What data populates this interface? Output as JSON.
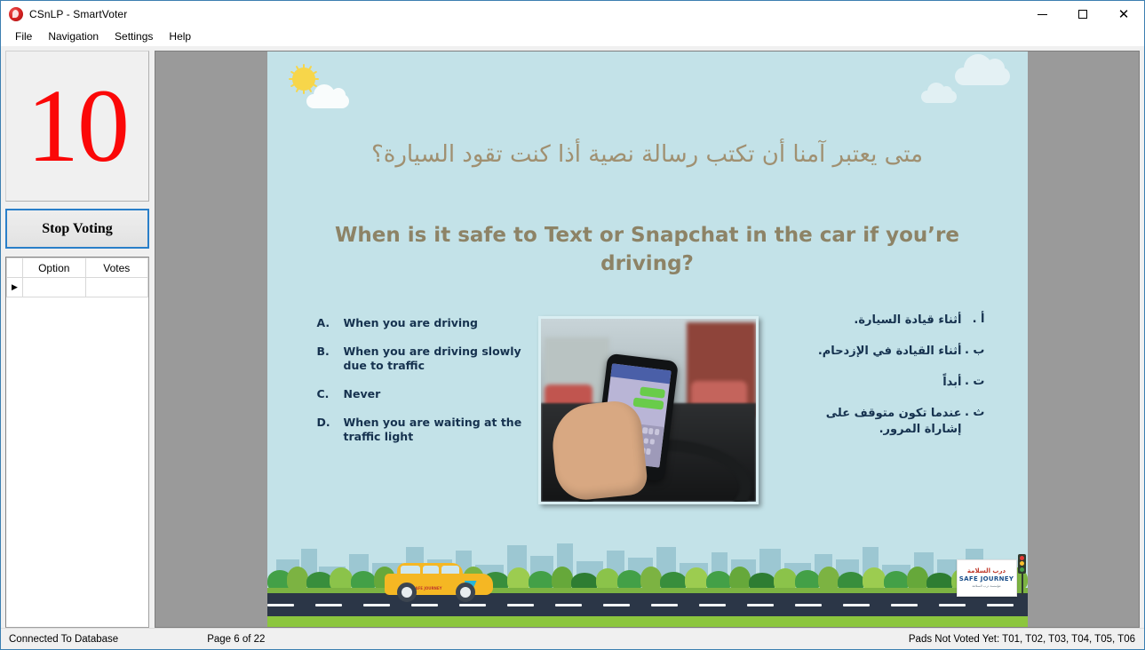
{
  "window": {
    "title": "CSnLP - SmartVoter",
    "icon": "app-logo-icon",
    "controls": {
      "minimize": "–",
      "maximize": "☐",
      "close": "✕"
    }
  },
  "menubar": {
    "items": [
      {
        "label": "File"
      },
      {
        "label": "Navigation"
      },
      {
        "label": "Settings"
      },
      {
        "label": "Help"
      }
    ]
  },
  "sidebar": {
    "countdown": "10",
    "stop_button": "Stop Voting",
    "grid": {
      "columns": [
        "Option",
        "Votes"
      ],
      "rows": [
        {
          "option": "",
          "votes": ""
        }
      ],
      "row_marker": "▶"
    }
  },
  "slide": {
    "question_arabic": "متى يعتبر آمنا أن تكتب رسالة نصية أذا كنت تقود السيارة؟",
    "question_english": "When is it safe to Text or Snapchat in the car if you’re driving?",
    "answers_english": [
      {
        "letter": "A.",
        "text": "When you are driving"
      },
      {
        "letter": "B.",
        "text": "When you are driving slowly due to traffic"
      },
      {
        "letter": "C.",
        "text": "Never"
      },
      {
        "letter": "D.",
        "text": "When you are waiting at the traffic light"
      }
    ],
    "answers_arabic": [
      {
        "letter": "أ .",
        "text": "أثناء قيادة السيارة."
      },
      {
        "letter": "ب .",
        "text": "أثناء القيادة في الإزدحام."
      },
      {
        "letter": "ت .",
        "text": "أبداً"
      },
      {
        "letter": "ث .",
        "text": "عندما تكون متوقف على إشاراة المرور."
      }
    ],
    "photo_alt": "hand-holding-phone-while-driving-photo",
    "billboard": {
      "arabic": "درب السلامة",
      "english": "SAFE JOURNEY",
      "subtitle": "مؤسسة درب السلامة"
    },
    "vehicle_label": "SAFE JOURNEY"
  },
  "statusbar": {
    "connection": "Connected To Database",
    "page": "Page 6 of 22",
    "pads": "Pads Not Voted Yet: T01, T02, T03, T04, T05, T06"
  },
  "colors": {
    "countdown_red": "#fb0808",
    "focus_blue": "#2a7fc9",
    "slide_sky": "#c3e2e8",
    "question_text": "#a09071",
    "answer_text": "#16324f",
    "road": "#2b3647",
    "grass": "#8cc63e",
    "vehicle": "#f5b723",
    "letterbox_gray": "#9a9a9a"
  }
}
